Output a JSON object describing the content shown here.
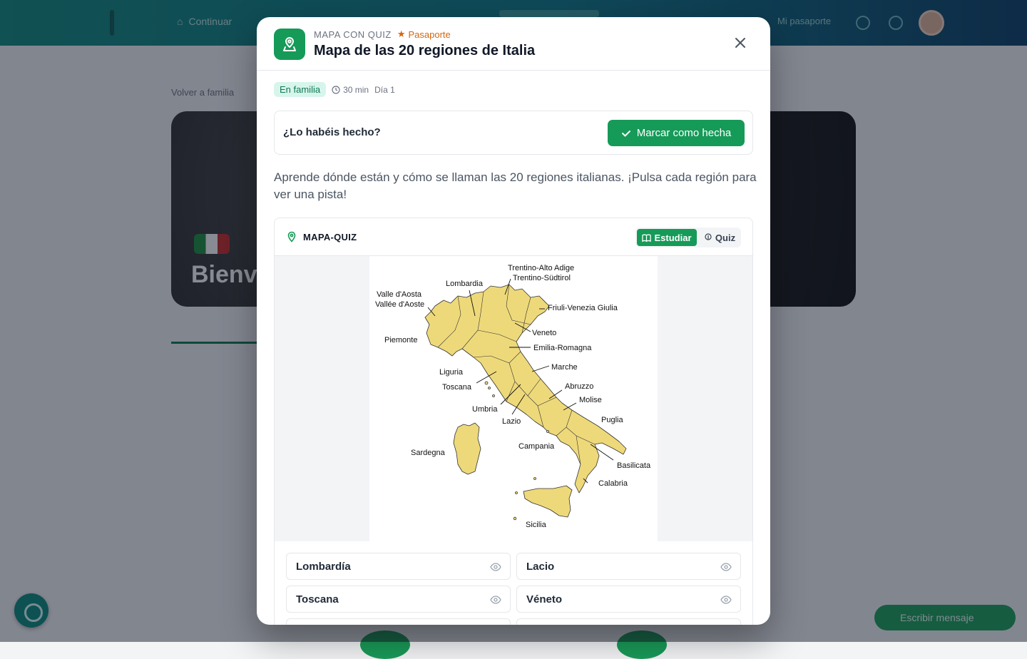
{
  "background": {
    "nav_item": "Continuar",
    "right_nav": "Mi pasaporte",
    "breadcrumb": "Volver a familia",
    "hero_title": "Bienvenidos",
    "send_label": "Escribir mensaje"
  },
  "modal": {
    "kicker": "MAPA CON QUIZ",
    "badge": "Pasaporte",
    "title": "Mapa de las 20 regiones de Italia",
    "meta": {
      "tag": "En familia",
      "duration": "30 min",
      "day": "Día 1"
    },
    "done": {
      "question": "¿Lo habéis hecho?",
      "button": "Marcar como hecha"
    },
    "description": "Aprende dónde están y cómo se llaman las 20 regiones italianas. ¡Pulsa cada región para ver una pista!",
    "quiz": {
      "title": "MAPA-QUIZ",
      "mode_study": "Estudiar",
      "mode_quiz": "Quiz",
      "active_mode": "Estudiar"
    },
    "map_labels": {
      "trentino1": "Trentino-Alto Adige",
      "trentino2": "Trentino-Südtirol",
      "lombardia": "Lombardia",
      "valle1": "Valle d'Aosta",
      "valle2": "Vallée d'Aoste",
      "friuli": "Friuli-Venezia Giulia",
      "veneto": "Veneto",
      "piemonte": "Piemonte",
      "emilia": "Emilia-Romagna",
      "marche": "Marche",
      "liguria": "Liguria",
      "toscana": "Toscana",
      "abruzzo": "Abruzzo",
      "molise": "Molise",
      "umbria": "Umbria",
      "lazio": "Lazio",
      "puglia": "Puglia",
      "campania": "Campania",
      "sardegna": "Sardegna",
      "basilicata": "Basilicata",
      "calabria": "Calabria",
      "sicilia": "Sicilia"
    },
    "regions": [
      "Lombardía",
      "Lacio",
      "Toscana",
      "Véneto"
    ],
    "colors": {
      "accent": "#169a58",
      "land": "#eed97a",
      "badge": "#d4660f"
    }
  }
}
